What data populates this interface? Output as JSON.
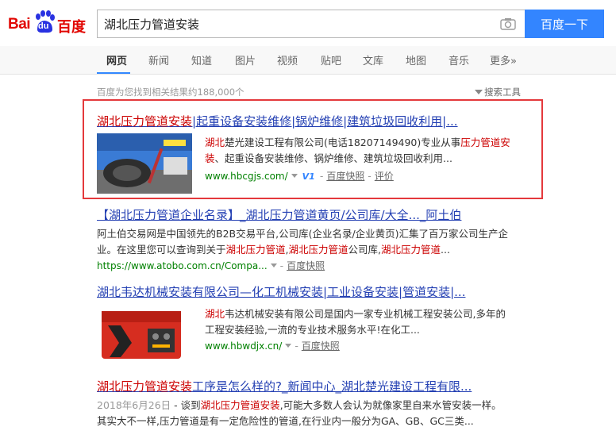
{
  "logo": {
    "bai": "Bai",
    "du": "du",
    "baidu_cn": "百度"
  },
  "search": {
    "query": "湖北压力管道安装",
    "button_label": "百度一下"
  },
  "tabs": [
    {
      "label": "网页"
    },
    {
      "label": "新闻"
    },
    {
      "label": "知道"
    },
    {
      "label": "图片"
    },
    {
      "label": "视频"
    },
    {
      "label": "贴吧"
    },
    {
      "label": "文库"
    },
    {
      "label": "地图"
    },
    {
      "label": "音乐"
    },
    {
      "label": "更多»"
    }
  ],
  "result_count": "百度为您找到相关结果约188,000个",
  "search_tools": "搜索工具",
  "results": [
    {
      "title_em": "湖北压力管道安装",
      "title_rest": "|起重设备安装维修|锅炉维修|建筑垃圾回收利用|...",
      "body_em1": "湖北",
      "body_a": "楚光建设工程有限公司(电话18207149490)专业从事",
      "body_em2": "压力管道安",
      "body_em3": "装",
      "body_b": "、起重设备安装维修、锅炉维修、建筑垃圾回收利用...",
      "url": "www.hbcgjs.com/",
      "v1": "V1",
      "snapshot": "百度快照",
      "rating": "评价"
    },
    {
      "title": "【湖北压力管道企业名录】_湖北压力管道黄页/公司库/大全..._阿土伯",
      "body_line1": "阿土伯交易网是中国领先的B2B交易平台,公司库(企业名录/企业黄页)汇集了百万家公司生产企",
      "body_line2_a": "业。在这里您可以查询到关于",
      "body_em1": "湖北压力管道",
      "body_sep1": ",",
      "body_em2": "湖北压力管道",
      "body_mid": "公司库,",
      "body_em3": "湖北压力管道",
      "body_end": "...",
      "url": "https://www.atobo.com.cn/Compa...",
      "snapshot": "百度快照"
    },
    {
      "title": "湖北韦达机械安装有限公司—化工机械安装|工业设备安装|管道安装|...",
      "body_em1": "湖北",
      "body_line1": "韦达机械安装有限公司是国内一家专业机械工程安装公司,多年的",
      "body_line2": "工程安装经验,一流的专业技术服务水平!在化工...",
      "url": "www.hbwdjx.cn/",
      "snapshot": "百度快照"
    },
    {
      "title_em": "湖北压力管道安装",
      "title_rest": "工序是怎么样的?_新闻中心_湖北楚光建设工程有限...",
      "date": "2018年6月26日",
      "body_a": " - 谈到",
      "body_em": "湖北压力管道安装",
      "body_b": ",可能大多数人会认为就像家里自来水管安装一样。",
      "body_line2": "其实大不一样,压力管道是有一定危险性的管道,在行业内一般分为GA、GB、GC三类..."
    }
  ],
  "colors": {
    "link_blue": "#2440b3",
    "highlight_red": "#c00",
    "url_green": "#008000",
    "button_blue": "#3385ff",
    "box_border_red": "#e4393c"
  },
  "icons": [
    "camera-icon",
    "filter-icon",
    "dropdown-arrow-icon",
    "verified-v1-icon",
    "baidu-paw-logo"
  ]
}
